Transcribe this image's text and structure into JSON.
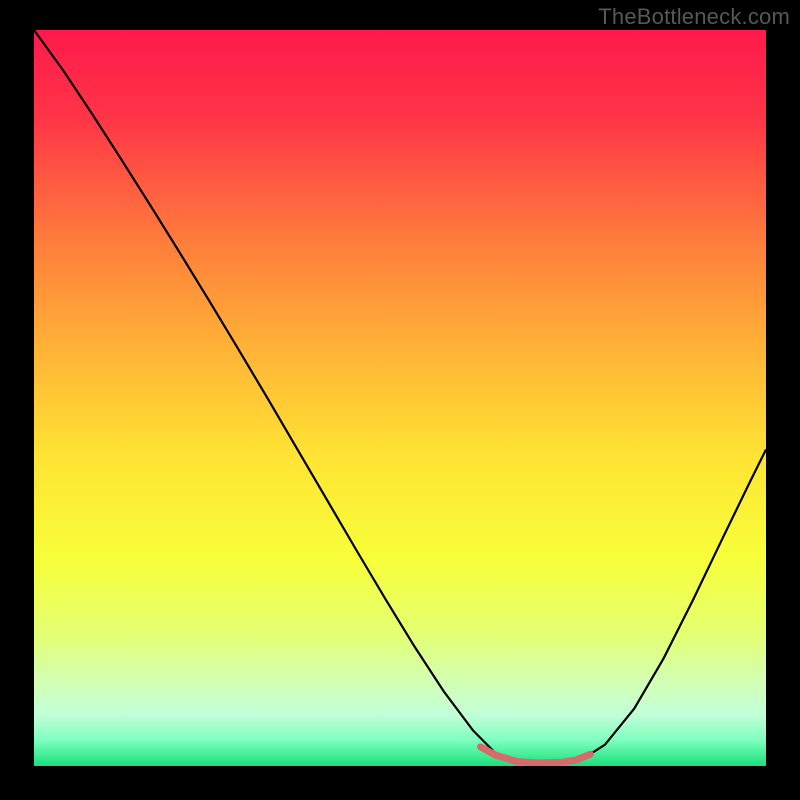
{
  "watermark": "TheBottleneck.com",
  "chart_data": {
    "type": "line",
    "title": "",
    "xlabel": "",
    "ylabel": "",
    "xlim": [
      0,
      100
    ],
    "ylim": [
      0,
      100
    ],
    "background_gradient": {
      "stops": [
        {
          "offset": 0.0,
          "color": "#ff1a4b"
        },
        {
          "offset": 0.12,
          "color": "#ff3547"
        },
        {
          "offset": 0.28,
          "color": "#ff7a3c"
        },
        {
          "offset": 0.44,
          "color": "#ffb536"
        },
        {
          "offset": 0.58,
          "color": "#ffe434"
        },
        {
          "offset": 0.72,
          "color": "#f7ff3a"
        },
        {
          "offset": 0.82,
          "color": "#e4ff72"
        },
        {
          "offset": 0.88,
          "color": "#d4ffae"
        },
        {
          "offset": 0.93,
          "color": "#c2ffd9"
        },
        {
          "offset": 0.965,
          "color": "#7effc0"
        },
        {
          "offset": 1.0,
          "color": "#18e079"
        }
      ]
    },
    "series": [
      {
        "name": "bottleneck-curve",
        "color": "#000000",
        "width": 2.2,
        "x": [
          0,
          4,
          8,
          12,
          16,
          20,
          24,
          28,
          32,
          36,
          40,
          44,
          48,
          52,
          56,
          60,
          63,
          66,
          69,
          72,
          75,
          78,
          82,
          86,
          90,
          94,
          98,
          100
        ],
        "y": [
          100,
          94.5,
          88.5,
          82.3,
          76.0,
          69.6,
          63.1,
          56.5,
          49.8,
          43.0,
          36.2,
          29.4,
          22.7,
          16.2,
          10.1,
          4.8,
          1.8,
          0.6,
          0.4,
          0.5,
          1.0,
          2.9,
          7.8,
          14.6,
          22.5,
          30.8,
          39.0,
          43.0
        ]
      },
      {
        "name": "flat-bottom-highlight",
        "color": "#d76a6a",
        "width": 7,
        "linecap": "round",
        "x": [
          61,
          63,
          66,
          69,
          72,
          74,
          76
        ],
        "y": [
          2.6,
          1.5,
          0.6,
          0.4,
          0.5,
          0.8,
          1.6
        ]
      }
    ]
  }
}
